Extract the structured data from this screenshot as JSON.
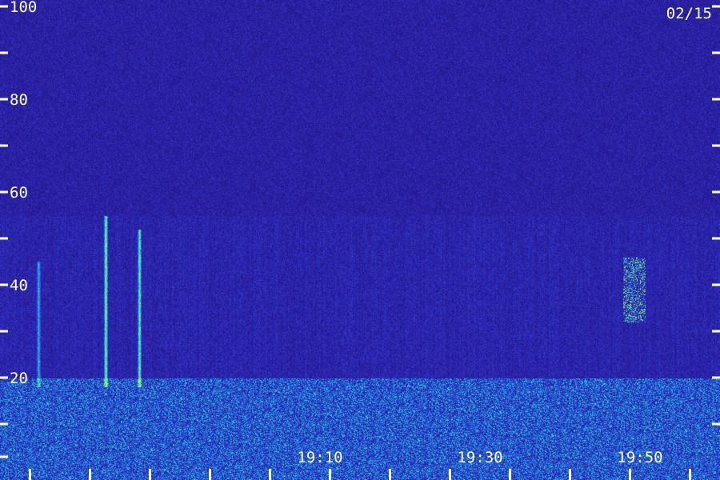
{
  "chart_data": {
    "type": "heatmap",
    "title": "",
    "date_label": "02/15",
    "xlabel": "",
    "ylabel": "",
    "y_axis": {
      "range": [
        0,
        100
      ],
      "major_ticks": [
        20,
        40,
        60,
        80,
        100
      ],
      "minor_ticks": [
        10,
        30,
        50,
        70,
        90
      ],
      "labels": [
        "20",
        "40",
        "60",
        "80",
        "100"
      ]
    },
    "x_axis": {
      "range_minutes": [
        18.5,
        20.0
      ],
      "labels": [
        {
          "text": "19:10",
          "t": 19.1667
        },
        {
          "text": "19:30",
          "t": 19.5
        },
        {
          "text": "19:50",
          "t": 19.8333
        }
      ],
      "tick_times": [
        18.5625,
        18.6875,
        18.8125,
        18.9375,
        19.0625,
        19.1875,
        19.3125,
        19.4375,
        19.5625,
        19.6875,
        19.8125,
        19.9375
      ]
    },
    "colormap": [
      "#1a0a5e",
      "#2a1a9a",
      "#2f3dd6",
      "#1f8fe8",
      "#20e8d0",
      "#b8f040"
    ],
    "features": {
      "background_level": 0.12,
      "noise_band": {
        "ymax": 20,
        "level": 0.55
      },
      "emission_region": {
        "ymin": 20,
        "ymax": 55,
        "level": 0.3
      },
      "vertical_streaks": [
        {
          "t": 18.72,
          "ymin": 18,
          "ymax": 55,
          "level": 0.95
        },
        {
          "t": 18.79,
          "ymin": 18,
          "ymax": 52,
          "level": 0.85
        },
        {
          "t": 18.58,
          "ymin": 18,
          "ymax": 45,
          "level": 0.55
        }
      ],
      "burst": {
        "t": 19.82,
        "ymin": 32,
        "ymax": 46,
        "level": 0.9
      }
    }
  }
}
